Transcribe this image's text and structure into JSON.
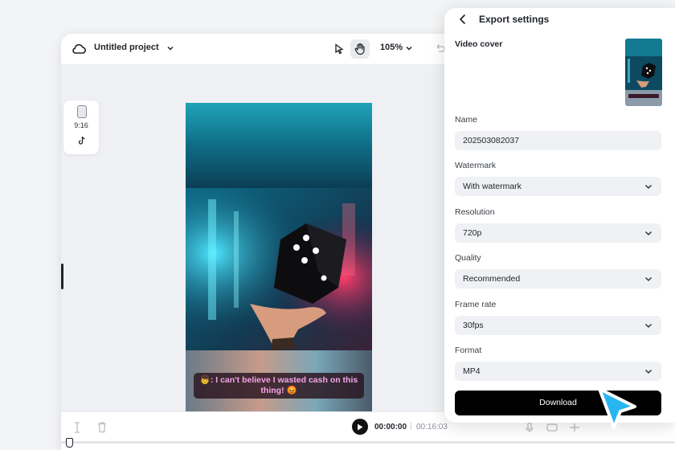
{
  "editor": {
    "project_title": "Untitled project",
    "zoom_level": "105%",
    "aspect_ratio": "9:16",
    "time_current": "00:00:00",
    "time_separator": "|",
    "time_total": "00:16:03",
    "caption_text": "👦: I can't believe I wasted cash on this thing! 😡"
  },
  "export_panel": {
    "title": "Export settings",
    "video_cover_label": "Video cover",
    "fields": {
      "name": {
        "label": "Name",
        "value": "202503082037"
      },
      "watermark": {
        "label": "Watermark",
        "value": "With watermark"
      },
      "resolution": {
        "label": "Resolution",
        "value": "720p"
      },
      "quality": {
        "label": "Quality",
        "value": "Recommended"
      },
      "frame_rate": {
        "label": "Frame rate",
        "value": "30fps"
      },
      "format": {
        "label": "Format",
        "value": "MP4"
      }
    },
    "download_label": "Download"
  },
  "colors": {
    "accent_cursor": "#27b6f0",
    "button_dark": "#000000",
    "caption_text": "#f6a4e8"
  },
  "icons": [
    "cloud-icon",
    "chevron-down-icon",
    "pointer-icon",
    "hand-icon",
    "undo-icon",
    "phone-icon",
    "tiktok-icon",
    "split-icon",
    "trash-icon",
    "play-icon",
    "back-icon",
    "cursor-icon"
  ]
}
